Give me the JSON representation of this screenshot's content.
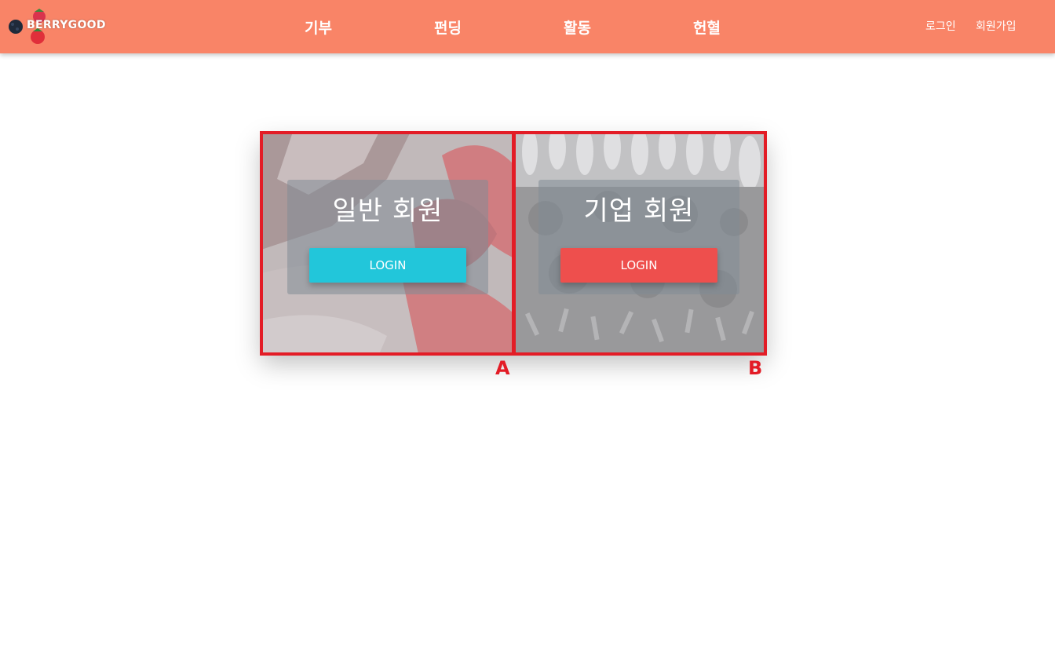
{
  "header": {
    "logo_text": "BERRYGOOD",
    "nav": [
      "기부",
      "펀딩",
      "활동",
      "헌혈"
    ],
    "login": "로그인",
    "signup": "회원가입"
  },
  "cards": [
    {
      "title": "일반 회원",
      "button": "LOGIN",
      "label": "A",
      "button_color": "#22c6da"
    },
    {
      "title": "기업 회원",
      "button": "LOGIN",
      "label": "B",
      "button_color": "#ee4f4d"
    }
  ],
  "colors": {
    "header_bg": "#f98467",
    "highlight_border": "#e31c26"
  }
}
